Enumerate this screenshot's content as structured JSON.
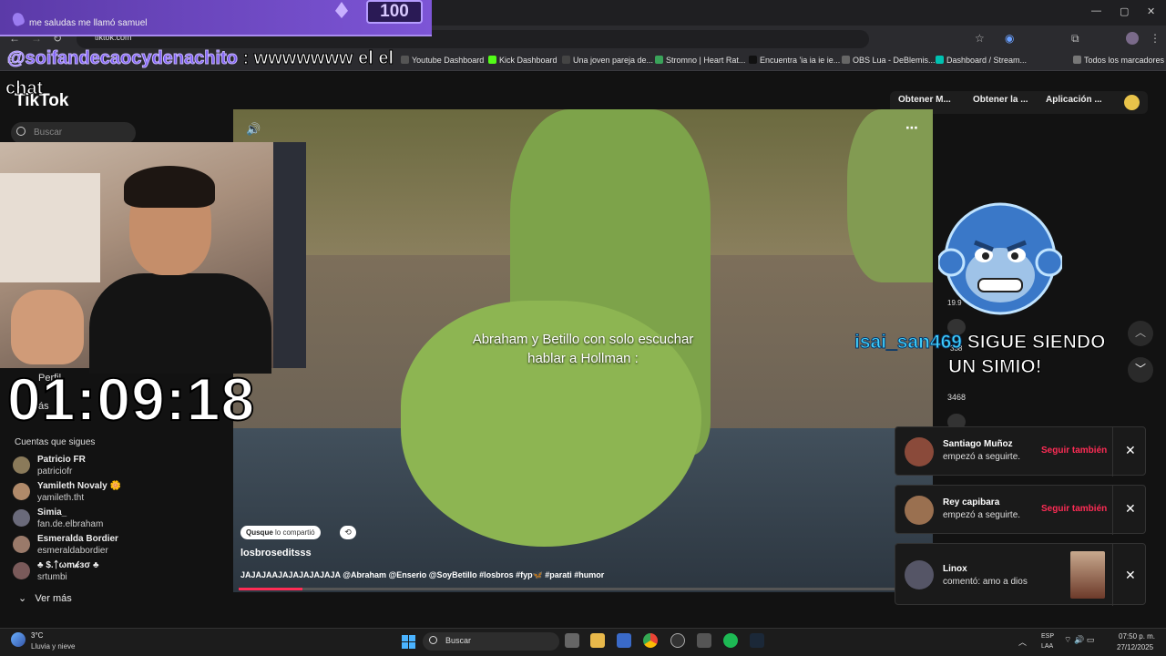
{
  "browser": {
    "url": "tiktok.com",
    "window_controls": [
      "—",
      "▢",
      "✕"
    ],
    "bookmarks": [
      {
        "label": "Youtube Dashboard",
        "color": "#555555"
      },
      {
        "label": "Kick Dashboard",
        "color": "#53fc18"
      },
      {
        "label": "Una joven pareja de...",
        "color": "#444444"
      },
      {
        "label": "Stromno | Heart Rat...",
        "color": "#3aa35a"
      },
      {
        "label": "Encuentra 'ia ia ie ie...",
        "color": "#111111"
      },
      {
        "label": "OBS Lua - DeBlemis...",
        "color": "#666666"
      },
      {
        "label": "Dashboard / Stream...",
        "color": "#00c2b2"
      },
      {
        "label": "Todos los marcadores",
        "color": "#777777"
      }
    ],
    "bookmark_partial": "E"
  },
  "overlay": {
    "alert_message": "me saludas me llamó samuel",
    "alert_count": "100",
    "chat_label": "chat",
    "chat_name": "@soifandecaocydenachito",
    "chat_text": ": wwwwwww el el",
    "timer": "01:09:18",
    "follow_alert_name": "isai_san469",
    "follow_alert_text_1": "SIGUE SIENDO",
    "follow_alert_text_2": "UN SIMIO!"
  },
  "tiktok": {
    "logo": "TikTok",
    "search_placeholder": "Buscar",
    "top_buttons": [
      "Obtener M...",
      "Obtener la ...",
      "Aplicación ..."
    ],
    "sidebar_profile": "Perfil",
    "sidebar_more": "ás",
    "following_title": "Cuentas que sigues",
    "following": [
      {
        "name": "Patricio FR",
        "handle": "patriciofr",
        "color": "#8a7a5a"
      },
      {
        "name": "Yamileth Novaly 🌼",
        "handle": "yamileth.tht",
        "color": "#b08a6a"
      },
      {
        "name": "Simia_",
        "handle": "fan.de.elbraham",
        "color": "#6a6a7a"
      },
      {
        "name": "Esmeralda Bordier",
        "handle": "esmeraldabordier",
        "color": "#9a7a6a"
      },
      {
        "name": "♣ $.ᛏωm𝓀ɜσ ♣",
        "handle": "srtumbi",
        "color": "#7a5a5a"
      }
    ],
    "see_more": "Ver más",
    "video": {
      "caption": "Abraham y Betillo con solo escuchar hablar a Hollman :",
      "shared_by": "Qusque",
      "shared_text": "lo compartió",
      "author": "losbroseditsss",
      "description": "JAJAJAAJAJAJAJAJAJA @Abraham @Enserio @SoyBetillo #losbros #fyp🦋 #parati #humor",
      "progress": 0.097,
      "likes": "19.9",
      "comments": "338",
      "saves": "3468"
    }
  },
  "notifications": [
    {
      "name": "Santiago Muñoz",
      "message": "empezó a seguirte.",
      "action": "Seguir también",
      "avatar_color": "#8a4a3a"
    },
    {
      "name": "Rey capibara",
      "message": "empezó a seguirte.",
      "action": "Seguir también",
      "avatar_color": "#9a7050"
    },
    {
      "name": "Linox",
      "message": "comentó: amo a dios",
      "action": "",
      "avatar_color": "#555566"
    }
  ],
  "taskbar": {
    "weather_temp": "3°C",
    "weather_desc": "Lluvia y nieve",
    "search_label": "Buscar",
    "lang_1": "ESP",
    "lang_2": "LAA",
    "time": "07:50 p. m.",
    "date": "27/12/2025"
  }
}
